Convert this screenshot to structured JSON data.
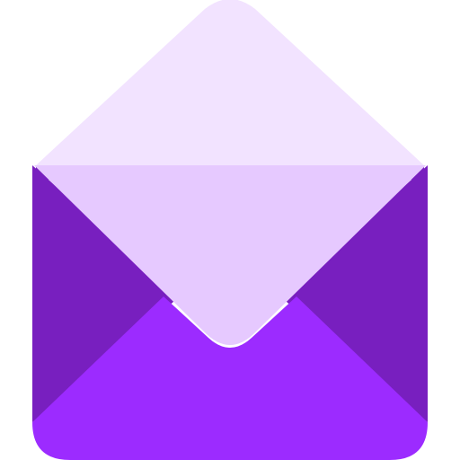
{
  "icon": {
    "name": "open-envelope-icon",
    "colors": {
      "flap_outer": "#F2E3FF",
      "flap_inner": "#E6C9FF",
      "side_panels": "#781FBF",
      "front_panel": "#9C2BFF",
      "background": "#FFFFFF"
    }
  }
}
